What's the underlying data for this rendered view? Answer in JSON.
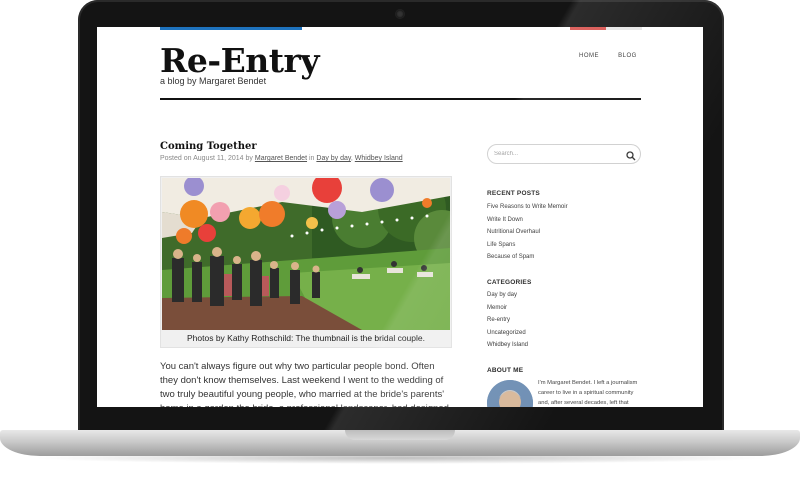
{
  "site": {
    "title": "Re-Entry",
    "tagline": "a blog by Margaret Bendet"
  },
  "nav": {
    "items": [
      "HOME",
      "BLOG"
    ]
  },
  "post": {
    "title": "Coming Together",
    "meta_posted_on": "Posted on",
    "date": "August 11, 2014",
    "meta_by": "by",
    "author": "Margaret Bendet",
    "meta_in": "in",
    "category_1": "Day by day",
    "category_separator": ",",
    "category_2": "Whidbey Island",
    "caption": "Photos by Kathy Rothschild: The thumbnail is the bridal couple.",
    "body": "You can't always figure out why two particular people bond. Often they don't know themselves. Last weekend I went to the wedding of two truly beautiful young people, who married at the bride's parents' home in a garden the bride, a professional landscaper, had designed and her mother"
  },
  "sidebar": {
    "search_placeholder": "Search...",
    "recent_posts": {
      "title": "RECENT POSTS",
      "items": [
        "Five Reasons to Write Memoir",
        "Write It Down",
        "Nutritional Overhaul",
        "Life Spans",
        "Because of Spam"
      ]
    },
    "categories": {
      "title": "CATEGORIES",
      "items": [
        "Day by day",
        "Memoir",
        "Re-entry",
        "Uncategorized",
        "Whidbey Island"
      ]
    },
    "about": {
      "title": "ABOUT ME",
      "text": "I'm Margaret Bendet. I left a journalism career to live in a spiritual community and, after several decades, left that community"
    }
  },
  "colors": {
    "accent_blue": "#1e73be",
    "accent_red": "#d9534f",
    "text_dark": "#111111"
  }
}
